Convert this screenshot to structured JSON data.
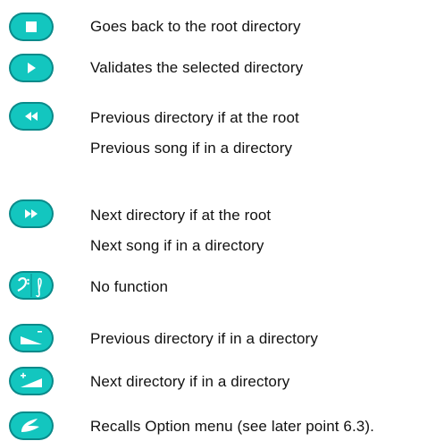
{
  "colors": {
    "button_body": "#13c6bf",
    "button_border": "#0a8a8a",
    "icon": "#ffffff",
    "text": "#111111"
  },
  "rows": [
    {
      "icon": "stop-icon",
      "lines": [
        "Goes back to the root directory"
      ]
    },
    {
      "icon": "play-icon",
      "lines": [
        "Validates the selected directory"
      ]
    },
    {
      "icon": "rewind-icon",
      "lines": [
        "Previous directory if at the root",
        "Previous song if in a directory"
      ]
    },
    {
      "icon": "fast-forward-icon",
      "lines": [
        "Next directory if at the root",
        "Next song if in a directory"
      ]
    },
    {
      "icon": "music-clef-icon",
      "lines": [
        "No function"
      ]
    },
    {
      "icon": "minus-icon",
      "lines": [
        "Previous directory if in a directory"
      ]
    },
    {
      "icon": "plus-icon",
      "lines": [
        "Next directory if in a directory"
      ]
    },
    {
      "icon": "option-menu-icon",
      "lines": [
        "Recalls Option menu (see later point 6.3)."
      ]
    }
  ]
}
